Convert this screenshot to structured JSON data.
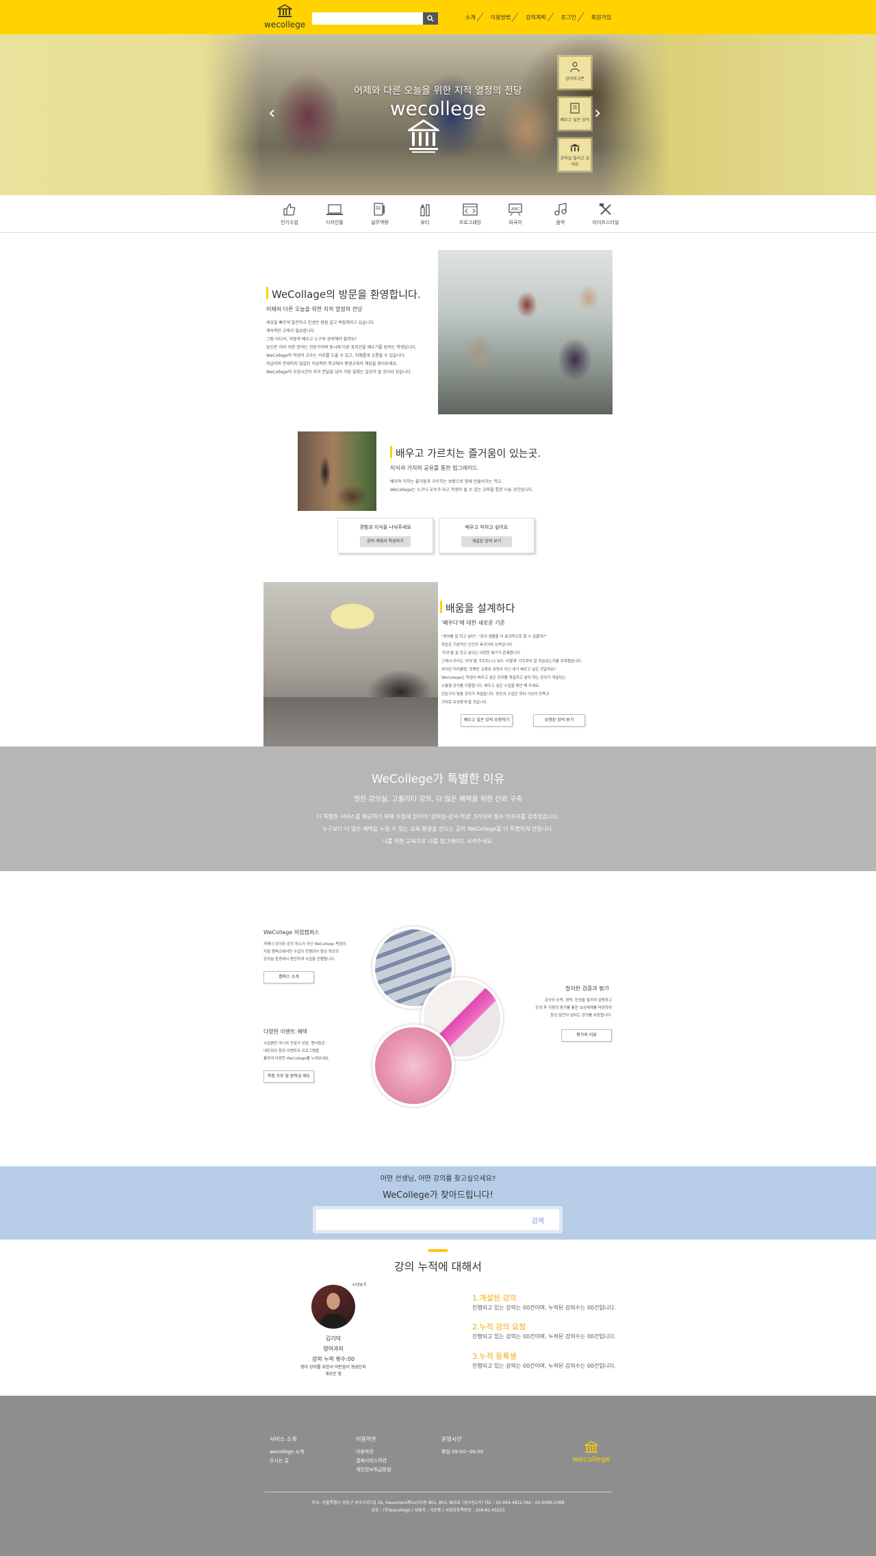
{
  "header": {
    "brand": "wecollege",
    "search_placeholder": "",
    "nav": [
      "소개",
      "이용방법",
      "강의계획",
      "로그인",
      "회원가입"
    ]
  },
  "hero": {
    "subtitle": "어제와 다른 오늘을 위한 지적 열정의 전당",
    "title": "wecollege",
    "quick_buttons": [
      "강의하고픈",
      "배우고 싶은 강의",
      "강의실 빌리고 싶어요"
    ]
  },
  "categories": [
    "인기수업",
    "디자인툴",
    "실무역량",
    "뷰티",
    "프로그래밍",
    "외국어",
    "음악",
    "라이프스타일"
  ],
  "welcome": {
    "title": "WeCollage의 방문을 환영합니다.",
    "subtitle": "어제와 다른 오늘을 위한 지적 열정의 전당",
    "body": [
      "세상을 빠르게 발전하고 인생은 점점 길고 복잡해지고 있습니다.",
      "계속적인 교육이 필요합니다.",
      "그럼 어디서, 어떻게 배우고 누구와 상의해야 할까요?",
      "당신은 이미 어떤 분야는 전문가이며 동시에 다른 포지션을 배우기를 원하는 학생입니다.",
      "WeCollege의 학생과 교수는 서로를 도울 수 있고, 지혜롭게 소통할 수 있습니다.",
      "지금까지 존재하지 않았던 이상적인 학교에서 평생교육의 해답을 찾아보세요.",
      "WeCollege의 수업시간이 지식 전달을 넘어 가장 설레는 일상이 될 것이라 믿습니다."
    ]
  },
  "joy": {
    "title": "배우고 가르치는 즐거움이 있는곳.",
    "subtitle": "지식과 가치의 공유를 통한 업그레이드",
    "body": [
      "배우며 익히는 즐거움과 가르치는 보람으로 함께 만들어가는 학교.",
      "WeCollege는 누구나 교수가 되고 학생이 될 수 있는 교육을 통한 나눔 공간입니다."
    ],
    "cards": [
      {
        "title": "경험과 지식을 나눠주세요",
        "button": "강의 계획서 작성하기"
      },
      {
        "title": "배우고 익히고 싶어요",
        "button": "개설된 강의 보기"
      }
    ]
  },
  "design": {
    "title": "배움을 설계하다",
    "subtitle": "'배우다'에 대한 새로운 기준",
    "body": [
      "\"영어를 잘 하고 싶다\", \"회사 생활을 더 효과적으로 할 수 없을까?\"",
      "학습은 기본적인 인간의 욕구이며 능력입니다.",
      "'무엇'을 잘 하고 싶다는 다양한 욕구가 존재합니다.",
      "그래서 우리는 '무엇'을 가르치느냐 보다 '어떻게' 가르쳐야 잘 학습되는지를 주목했습니다.",
      "위어진 커리큘럼, 정해진 교재와 과정이 아닌 내가 배우고 싶은 것일까요?",
      "WeCollege는 학생이 배우고 싶은 강의를 개설하고 싶어 하는 강의가 개설되는",
      "소통형 강의를 지향합니다. 배우고 싶은 수업을 제안 해 주세요.",
      "전문가의 맞춤 강의가 개설됩니다. 당신의 수업은 회차 가상의 만족과",
      "가치로 보상받게 될 것입니다."
    ],
    "buttons": [
      "배우고 싶은 강의 요청하기",
      "요청된 강의 보기"
    ]
  },
  "special": {
    "title": "WeCollege가 특별한 이유",
    "subtitle": "멋진 강의실, 고퀄리티 강의, 더 많은 혜택을 위한 신뢰 구축",
    "lines": [
      "더 특별한 서비스를 제공하기 위해 수업에 있어야 '강의실-강사-학생' 3가지의 필수 인프라를 갖추었습니다.",
      "누구보다 더 많은 혜택을 누릴 수 있는 교육 환경을 만드는 곳이 WeCollege를 더 특별하게 만듭니다.",
      "나를 위한 교육으로 나를 업그레이드 시켜주세요."
    ]
  },
  "campus": {
    "left_top": {
      "title": "WeCollage 저점캠퍼스",
      "body": [
        "카페나 강의와 강의 장소가 아닌 WeCollege 독점의",
        "저점 캠퍼스에서만 수업이 진행되어 항상 최상의",
        "강의실 환경에서 편안하게 수업을 진행합니다."
      ],
      "button": "캠퍼스 소개"
    },
    "left_bottom": {
      "title": "다양한 이벤트 혜택",
      "body": [
        "수업뿐만 아니라 전문가 상담, 멘사특강",
        "네트워크 등의 이벤트와 프로그램을",
        "통하여 다양한 WeCollege를 누려보세요."
      ],
      "button": "학점 가부 및 장학금 제도"
    },
    "right": {
      "title": "철저한 검증과 평가",
      "body": [
        "강사의 능력, 경력, 인성을 철저히 검증하고",
        "강의 후 지원의 평가를 통한 보상체계를 마련하여",
        "항상 발전이 넘치는 강의를 보장합니다."
      ],
      "button": "평가와 리뷰"
    }
  },
  "find": {
    "line1": "어떤 선생님, 어떤 강의를 찾고싶으세요?",
    "line2": "WeCollege가 찾아드립니다!",
    "button": "검색"
  },
  "stats": {
    "title": "강의 누적에 대해서",
    "profile": {
      "more": "+더보기",
      "name": "김기덕",
      "subject": "영어과외",
      "count": "강의 누적 횟수:00",
      "desc1": "영어 강의를 위한서 어떤음이 형성민지",
      "desc2": "개요인 힘"
    },
    "items": [
      {
        "title": "1.개설된 강의",
        "desc": "진행되고 있는 강의는 00건이며, 누적된 강의수는 00건입니다."
      },
      {
        "title": "2.누적 강의 요청",
        "desc": "진행되고 있는 강의는 00건이며, 누적된 강의수는 00건입니다."
      },
      {
        "title": "3.누적 등록생",
        "desc": "진행되고 있는 강의는 00건이며, 누적된 강의수는 00건입니다."
      }
    ]
  },
  "footer": {
    "col1": {
      "title": "서비스 소개",
      "links": [
        "wecollege 소개",
        "오시는 길"
      ]
    },
    "col2": {
      "title": "이용약관",
      "links": [
        "이용약관",
        "결제서비스약관",
        "개인정보취급방침"
      ]
    },
    "col3": {
      "title": "운영시간",
      "links": [
        "평일 09:00~06:00"
      ]
    },
    "brand": "wecollege",
    "addr1": "주소: 서울특별시 성동구 성수이로7길 26, Hausmenoffice(지)동 801, 804, 805호 (성수동2가) TEL : 02-464-4822 FAX : 02-6499-1368",
    "addr2": "상호 : (주)wecollege  |  대표자 : 이순중  |  사업자등록번호 : 204-81-45253"
  },
  "colors": {
    "brand": "#ffd200",
    "accent": "#f0a800",
    "band_gray": "#b6b6b6",
    "band_blue": "#b7cde7",
    "footer": "#8e8e8e"
  }
}
